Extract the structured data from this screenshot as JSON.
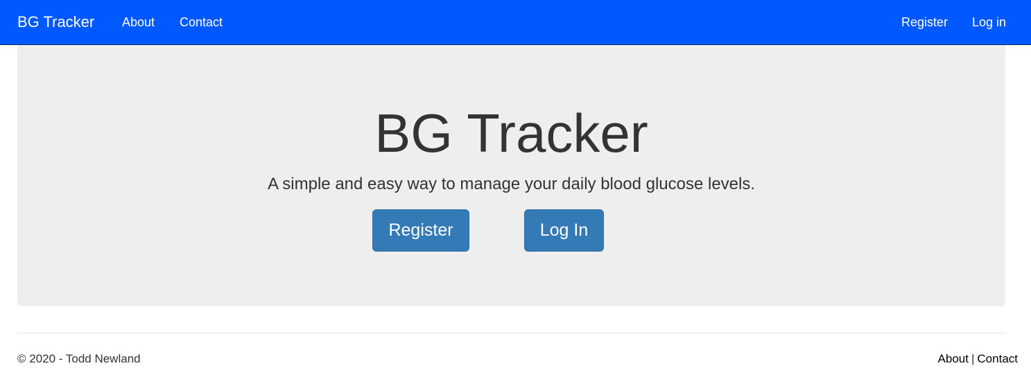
{
  "navbar": {
    "brand": "BG Tracker",
    "links_left": [
      "About",
      "Contact"
    ],
    "links_right": [
      "Register",
      "Log in"
    ],
    "background": "#0059ff"
  },
  "hero": {
    "title": "BG Tracker",
    "subtitle": "A simple and easy way to manage your daily blood glucose levels.",
    "register_label": "Register",
    "login_label": "Log In",
    "button_color": "#337ab7",
    "background": "#eeeeee"
  },
  "footer": {
    "copyright": "© 2020 - Todd Newland",
    "links": [
      "About",
      "Contact"
    ],
    "separator": "|"
  }
}
